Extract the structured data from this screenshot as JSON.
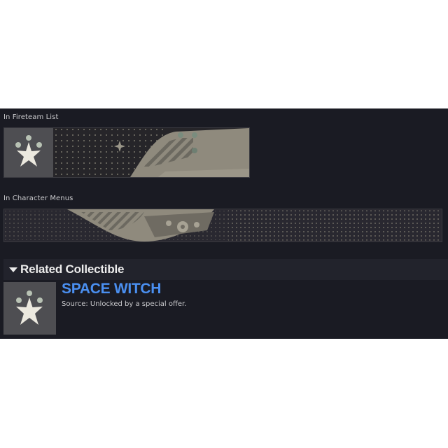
{
  "fireteam_caption": "In Fireteam List",
  "character_caption": "In Character Menus",
  "related": {
    "title": "Related Collectible",
    "name": "SPACE WITCH",
    "source": "Source: Unlocked by a special offer."
  },
  "icons": {
    "emblem": "star-emblem-icon",
    "toggle": "triangle-down-icon"
  },
  "colors": {
    "panel": "#1a1b23",
    "accent_name": "#4a8ff0",
    "emblem_bg": "#4e4e52",
    "banner_tan": "#8f8a7d"
  }
}
